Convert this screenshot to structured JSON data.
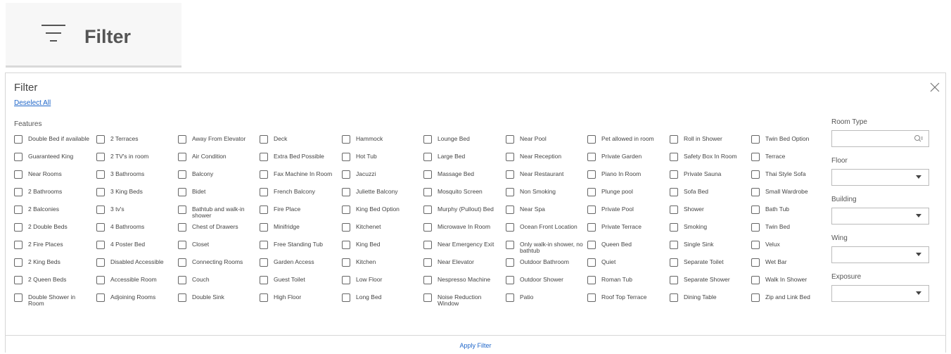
{
  "top_button": {
    "label": "Filter",
    "icon": "filter-lines-icon"
  },
  "panel": {
    "title": "Filter",
    "deselect_all": "Deselect All",
    "features_heading": "Features",
    "apply_label": "Apply Filter"
  },
  "features": [
    [
      "Double Bed if available",
      "Guaranteed King",
      "Near Rooms",
      "2 Bathrooms",
      "2 Balconies",
      "2 Double Beds",
      "2 Fire Places",
      "2 King Beds",
      "2 Queen Beds",
      "Double Shower in Room"
    ],
    [
      "2 Terraces",
      "2 TV's in room",
      "3 Bathrooms",
      "3 King Beds",
      "3 tv's",
      "4 Bathrooms",
      "4 Poster Bed",
      "Disabled Accessible",
      "Accessible Room",
      "Adjoining Rooms"
    ],
    [
      "Away From Elevator",
      "Air Condition",
      "Balcony",
      "Bidet",
      "Bathtub and walk-in shower",
      "Chest of Drawers",
      "Closet",
      "Connecting Rooms",
      "Couch",
      "Double Sink"
    ],
    [
      "Deck",
      "Extra Bed Possible",
      "Fax Machine In Room",
      "French Balcony",
      "Fire Place",
      "Minifridge",
      "Free Standing Tub",
      "Garden Access",
      "Guest Toilet",
      "High Floor"
    ],
    [
      "Hammock",
      "Hot Tub",
      "Jacuzzi",
      "Juliette Balcony",
      "King Bed Option",
      "Kitchenet",
      "King Bed",
      "Kitchen",
      "Low Floor",
      "Long Bed"
    ],
    [
      "Lounge Bed",
      "Large Bed",
      "Massage Bed",
      "Mosquito Screen",
      "Murphy (Pullout) Bed",
      "Microwave In Room",
      "Near Emergency Exit",
      "Near Elevator",
      "Nespresso Machine",
      "Noise Reduction Window"
    ],
    [
      "Near Pool",
      "Near Reception",
      "Near Restaurant",
      "Non Smoking",
      "Near Spa",
      "Ocean Front Location",
      "Only walk-in shower, no bathtub",
      "Outdoor Bathroom",
      "Outdoor Shower",
      "Patio"
    ],
    [
      "Pet allowed in room",
      "Private Garden",
      "Piano In Room",
      "Plunge pool",
      "Private Pool",
      "Private Terrace",
      "Queen Bed",
      "Quiet",
      "Roman Tub",
      "Roof Top Terrace"
    ],
    [
      "Roll in Shower",
      "Safety Box In Room",
      "Private Sauna",
      "Sofa Bed",
      "Shower",
      "Smoking",
      "Single Sink",
      "Separate Toilet",
      "Separate Shower",
      "Dining Table"
    ],
    [
      "Twin Bed Option",
      "Terrace",
      "Thai Style Sofa",
      "Small Wardrobe",
      "Bath Tub",
      "Twin Bed",
      "Velux",
      "Wet Bar",
      "Walk In Shower",
      "Zip and Link Bed"
    ]
  ],
  "right_filters": {
    "room_type": {
      "label": "Room Type",
      "value": ""
    },
    "floor": {
      "label": "Floor",
      "value": ""
    },
    "building": {
      "label": "Building",
      "value": ""
    },
    "wing": {
      "label": "Wing",
      "value": ""
    },
    "exposure": {
      "label": "Exposure",
      "value": ""
    }
  }
}
